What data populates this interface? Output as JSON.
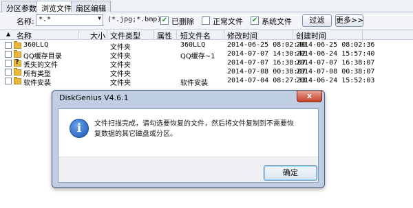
{
  "tabs": [
    {
      "label": "分区参数"
    },
    {
      "label": "浏览文件"
    },
    {
      "label": "扇区编辑"
    }
  ],
  "filter": {
    "name_label": "名称:",
    "name_value": "*.*",
    "hint": "(*.jpg;*.bmp)",
    "deleted_label": "已删除",
    "normal_label": "正常文件",
    "system_label": "系统文件",
    "filter_button": "过滤",
    "more_button": "更多>>"
  },
  "columns": {
    "name": "名称",
    "size": "大小",
    "type": "文件类型",
    "attr": "属性",
    "short": "短文件名",
    "modified": "修改时间",
    "created": "创建时间"
  },
  "rows": [
    {
      "name": "360LLQ",
      "type": "文件夹",
      "short": "360LLQ",
      "modified": "2014-06-25 08:02:40",
      "created": "2014-06-25 08:02:36"
    },
    {
      "name": "QQ缓存目录",
      "type": "文件夹",
      "short": "QQ缓存~1",
      "modified": "2014-07-07 14:30:42",
      "created": "2014-06-24 15:57:40"
    },
    {
      "name": "丢失的文件",
      "type": "文件夹",
      "short": "",
      "modified": "2014-07-07 16:38:07",
      "created": "2014-07-07 16:38:07"
    },
    {
      "name": "所有类型",
      "type": "文件夹",
      "short": "",
      "modified": "2014-07-08 00:38:07",
      "created": "2014-07-08 00:38:07"
    },
    {
      "name": "软件安装",
      "type": "文件夹",
      "short": "软件安装",
      "modified": "2014-07-04 08:27:33",
      "created": "2014-06-24 15:52:03"
    }
  ],
  "dialog": {
    "title": "DiskGenius V4.6.1",
    "close": "x",
    "message": "文件扫描完成，请勾选要恢复的文件，然后将文件复制到不需要恢复数据的其它磁盘或分区。",
    "ok": "确定",
    "icon": "info-icon"
  }
}
